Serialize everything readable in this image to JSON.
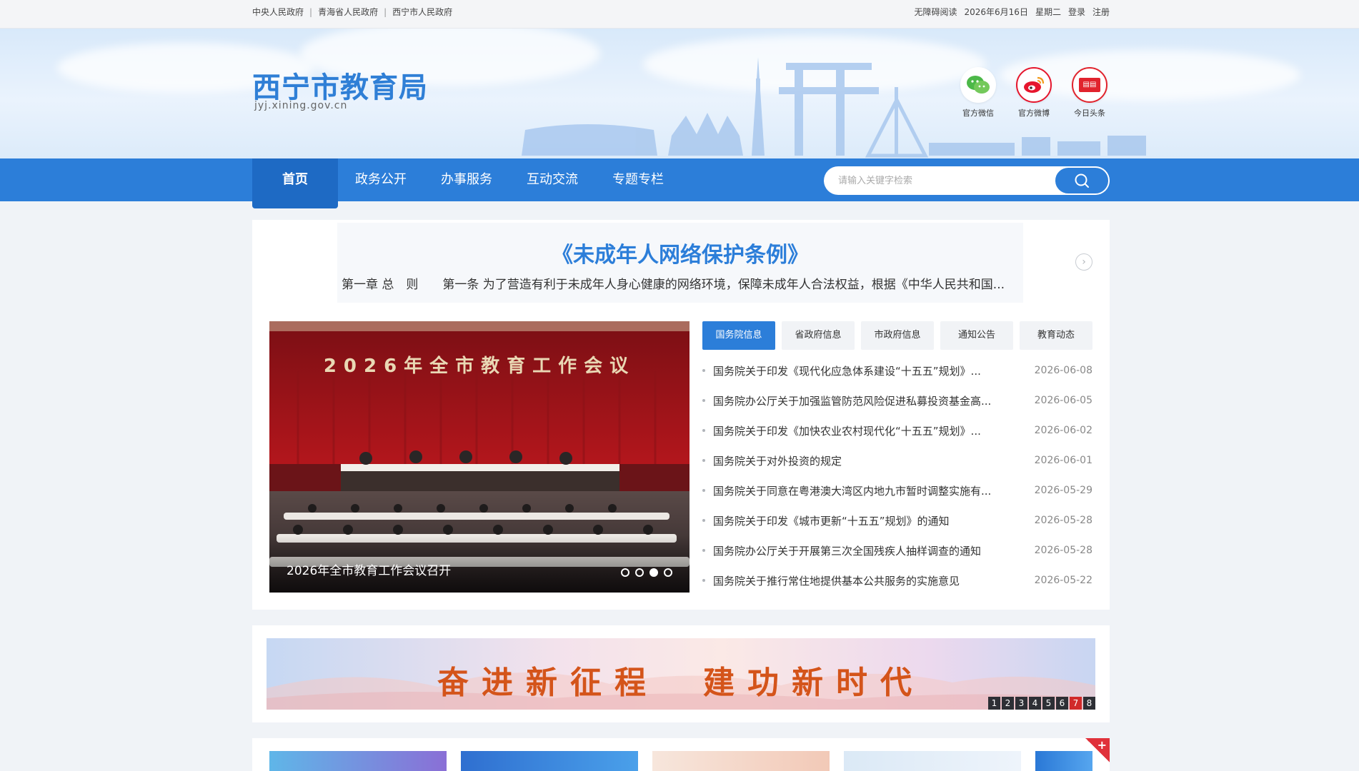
{
  "topbar": {
    "links": [
      "中央人民政府",
      "青海省人民政府",
      "西宁市人民政府"
    ],
    "separator": "|",
    "accessibility": "无障碍阅读",
    "date": "2026年6月16日",
    "weekday": "星期二",
    "login": "登录",
    "register": "注册"
  },
  "header": {
    "title": "西宁市教育局",
    "url": "jyj.xining.gov.cn",
    "social": [
      {
        "label": "官方微信",
        "icon": "wechat-icon",
        "color": "#4cb848"
      },
      {
        "label": "官方微博",
        "icon": "weibo-icon",
        "color": "#e6162d"
      },
      {
        "label": "今日头条",
        "icon": "toutiao-icon",
        "color": "#e1232d"
      }
    ]
  },
  "nav": {
    "items": [
      "首页",
      "政务公开",
      "办事服务",
      "互动交流",
      "专题专栏"
    ],
    "active": "首页",
    "search_placeholder": "请输入关键字检索"
  },
  "headline": {
    "title": "《未成年人网络保护条例》",
    "summary": "第一章 总　则　　第一条 为了营造有利于未成年人身心健康的网络环境，保障未成年人合法权益，根据《中华人民共和国..."
  },
  "carousel": {
    "banner_text": "2026年全市教育工作会议",
    "caption": "2026年全市教育工作会议召开",
    "dots": 4,
    "active_dot": 3
  },
  "tabs": {
    "items": [
      "国务院信息",
      "省政府信息",
      "市政府信息",
      "通知公告",
      "教育动态"
    ],
    "active": "国务院信息"
  },
  "news": [
    {
      "title": "国务院关于印发《现代化应急体系建设“十五五”规划》...",
      "date": "2026-06-08"
    },
    {
      "title": "国务院办公厅关于加强监管防范风险促进私募投资基金高...",
      "date": "2026-06-05"
    },
    {
      "title": "国务院关于印发《加快农业农村现代化“十五五”规划》...",
      "date": "2026-06-02"
    },
    {
      "title": "国务院关于对外投资的规定",
      "date": "2026-06-01"
    },
    {
      "title": "国务院关于同意在粤港澳大湾区内地九市暂时调整实施有...",
      "date": "2026-05-29"
    },
    {
      "title": "国务院关于印发《城市更新“十五五”规划》的通知",
      "date": "2026-05-28"
    },
    {
      "title": "国务院办公厅关于开展第三次全国残疾人抽样调查的通知",
      "date": "2026-05-28"
    },
    {
      "title": "国务院关于推行常住地提供基本公共服务的实施意见",
      "date": "2026-05-22"
    }
  ],
  "banner": {
    "slogan": "奋进新征程　建功新时代",
    "pages": [
      "1",
      "2",
      "3",
      "4",
      "5",
      "6",
      "7",
      "8"
    ],
    "active_page": "7"
  },
  "bottom": {
    "corner_symbol": "+"
  },
  "colors": {
    "brand": "#2c7ed9",
    "brand_dark": "#1e6ac4",
    "slogan": "#d4541a",
    "pager_active": "#d12a2a"
  }
}
